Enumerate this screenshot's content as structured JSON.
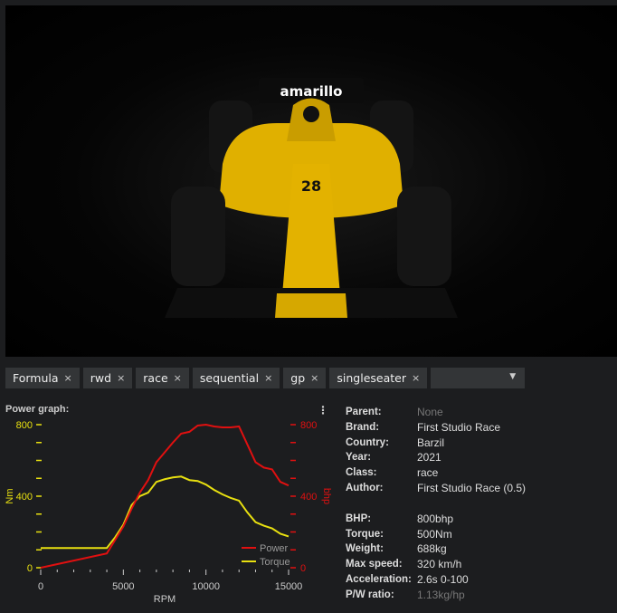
{
  "viewer": {
    "livery_text": "amarillo",
    "car_number": "28"
  },
  "tags": [
    "Formula",
    "rwd",
    "race",
    "sequential",
    "gp",
    "singleseater"
  ],
  "tag_remove_symbol": "×",
  "graph": {
    "title": "Power graph:",
    "menu_icon": "⋮"
  },
  "chart_data": {
    "type": "line",
    "title": "Power graph:",
    "xlabel": "RPM",
    "ylabel_left": "Nm",
    "ylabel_right": "bhp",
    "xlim": [
      0,
      15000
    ],
    "ylim": [
      0,
      800
    ],
    "xticks": [
      0,
      5000,
      10000,
      15000
    ],
    "yticks_left": [
      0,
      400,
      800
    ],
    "yticks_right": [
      0,
      400,
      800
    ],
    "legend_position": "bottom-right",
    "series": [
      {
        "name": "Power",
        "color": "#e01010",
        "axis": "right",
        "x": [
          0,
          4000,
          5000,
          5500,
          6000,
          6500,
          7000,
          8000,
          8500,
          9000,
          9500,
          10000,
          10500,
          11000,
          11500,
          12000,
          12500,
          13000,
          13500,
          14000,
          14500,
          15000
        ],
        "y": [
          0,
          80,
          230,
          330,
          420,
          490,
          590,
          700,
          750,
          760,
          795,
          800,
          790,
          785,
          785,
          790,
          690,
          590,
          560,
          550,
          480,
          460
        ]
      },
      {
        "name": "Torque",
        "color": "#e8e010",
        "axis": "left",
        "x": [
          0,
          4000,
          4500,
          5000,
          5500,
          6000,
          6500,
          7000,
          7500,
          8000,
          8500,
          9000,
          9500,
          10000,
          10500,
          11000,
          11500,
          12000,
          12500,
          13000,
          13500,
          14000,
          14500,
          15000
        ],
        "y": [
          110,
          110,
          170,
          240,
          350,
          400,
          420,
          480,
          495,
          505,
          510,
          490,
          485,
          465,
          435,
          410,
          390,
          375,
          310,
          255,
          235,
          220,
          190,
          175
        ]
      }
    ]
  },
  "info": [
    {
      "label": "Parent:",
      "value": "None",
      "dim": true
    },
    {
      "label": "Brand:",
      "value": "First Studio Race"
    },
    {
      "label": "Country:",
      "value": "Barzil"
    },
    {
      "label": "Year:",
      "value": "2021"
    },
    {
      "label": "Class:",
      "value": "race"
    },
    {
      "label": "Author:",
      "value": "First Studio Race (0.5)"
    }
  ],
  "specs": [
    {
      "label": "BHP:",
      "value": "800bhp"
    },
    {
      "label": "Torque:",
      "value": "500Nm"
    },
    {
      "label": "Weight:",
      "value": "688kg"
    },
    {
      "label": "Max speed:",
      "value": "320 km/h"
    },
    {
      "label": "Acceleration:",
      "value": "2.6s 0-100"
    },
    {
      "label": "P/W ratio:",
      "value": "1.13kg/hp",
      "dim": true
    }
  ]
}
